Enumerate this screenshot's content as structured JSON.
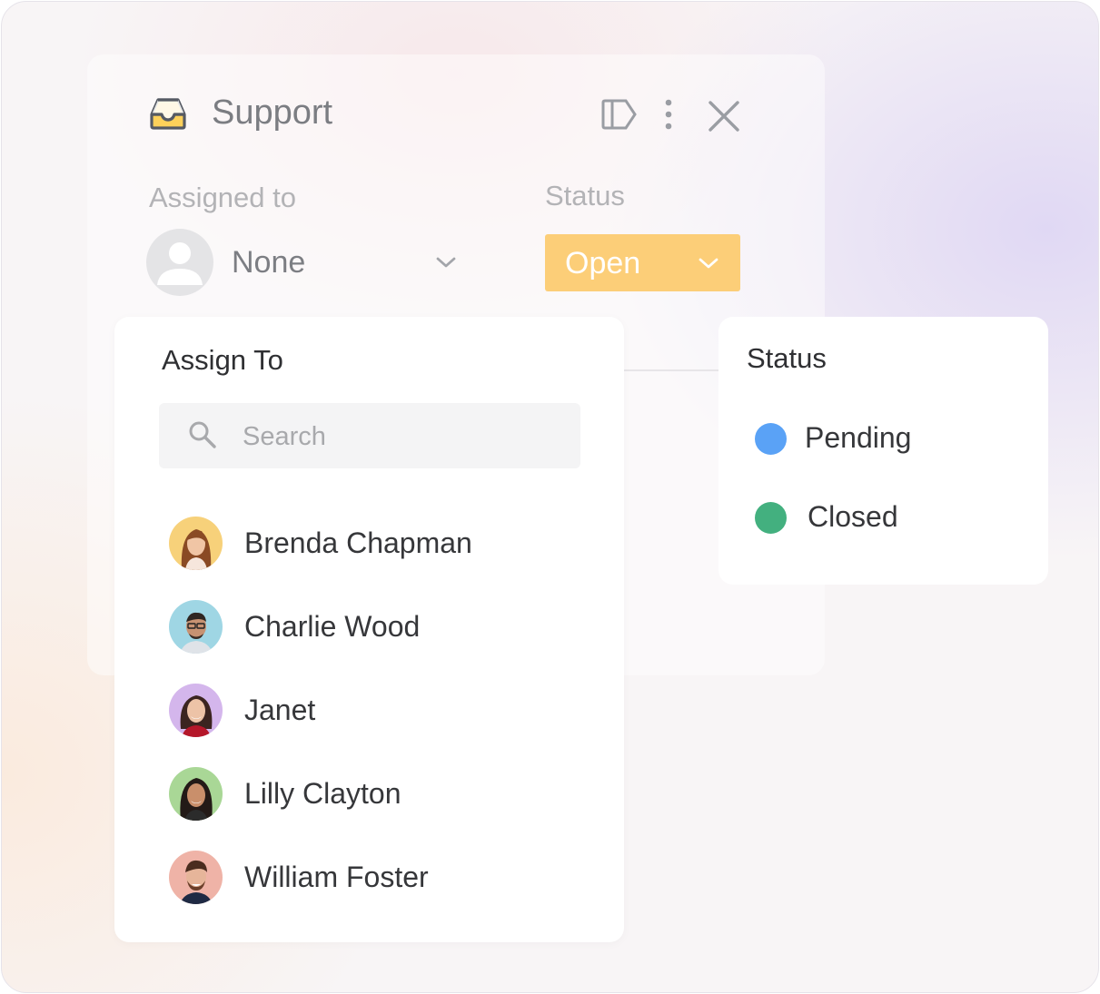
{
  "panel": {
    "title": "Support",
    "title_icon": "inbox-tray-icon",
    "header_icons": [
      "sidebar-toggle-icon",
      "more-vertical-icon",
      "close-icon"
    ],
    "assigned_label": "Assigned to",
    "assigned_value": "None",
    "status_label": "Status",
    "status_value": "Open",
    "status_color": "#fcce78"
  },
  "assign_dropdown": {
    "title": "Assign To",
    "search": {
      "placeholder": "Search",
      "value": ""
    },
    "people": [
      {
        "name": "Brenda Chapman",
        "avatar_bg": "#f7d17a"
      },
      {
        "name": "Charlie Wood",
        "avatar_bg": "#9fd6e4"
      },
      {
        "name": "Janet",
        "avatar_bg": "#d4b6ec"
      },
      {
        "name": "Lilly Clayton",
        "avatar_bg": "#a9d796"
      },
      {
        "name": "William Foster",
        "avatar_bg": "#efb3a7"
      }
    ]
  },
  "status_dropdown": {
    "title": "Status",
    "options": [
      {
        "label": "Pending",
        "color": "#5aa2f6"
      },
      {
        "label": "Closed",
        "color": "#43b07f"
      }
    ]
  }
}
